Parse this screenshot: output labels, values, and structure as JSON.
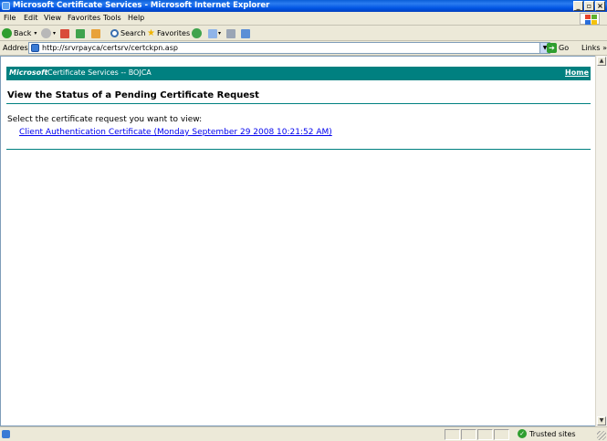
{
  "window": {
    "title": "Microsoft Certificate Services - Microsoft Internet Explorer",
    "minimize": "_",
    "maximize": "▫",
    "close": "×"
  },
  "menu": {
    "items": [
      "File",
      "Edit",
      "View",
      "Favorites",
      "Tools",
      "Help"
    ]
  },
  "toolbar": {
    "back_label": "Back",
    "search_label": "Search",
    "favorites_label": "Favorites"
  },
  "address": {
    "label": "Address",
    "url": "http://srvrpayca/certsrv/certckpn.asp",
    "go_label": "Go",
    "links_label": "Links"
  },
  "page": {
    "banner_brand": "Microsoft",
    "banner_text": "Certificate Services  --  BOJCA",
    "home_link": "Home",
    "heading": "View the Status of a Pending Certificate Request",
    "intro": "Select the certificate request you want to view:",
    "request_link": "Client Authentication Certificate (Monday September 29 2008 10:21:52 AM)"
  },
  "status": {
    "zone": "Trusted sites"
  },
  "colors": {
    "banner": "#008080",
    "link": "#0000ee",
    "titlebar": "#0054e3"
  }
}
